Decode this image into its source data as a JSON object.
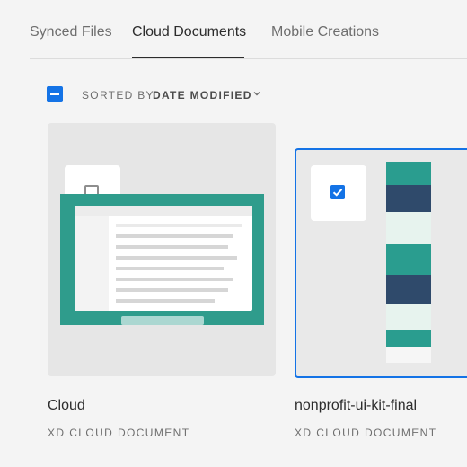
{
  "tabs": [
    {
      "label": "Synced Files"
    },
    {
      "label": "Cloud Documents"
    },
    {
      "label": "Mobile Creations"
    }
  ],
  "active_tab": "Cloud Documents",
  "sort": {
    "label": "SORTED BY",
    "value": "DATE MODIFIED"
  },
  "files": [
    {
      "name": "Cloud",
      "type": "XD CLOUD DOCUMENT",
      "selected": false
    },
    {
      "name": "nonprofit-ui-kit-final",
      "type": "XD CLOUD DOCUMENT",
      "selected": true
    }
  ],
  "colors": {
    "accent": "#1473e6",
    "background": "#f4f4f4",
    "card": "#e6e6e6"
  }
}
